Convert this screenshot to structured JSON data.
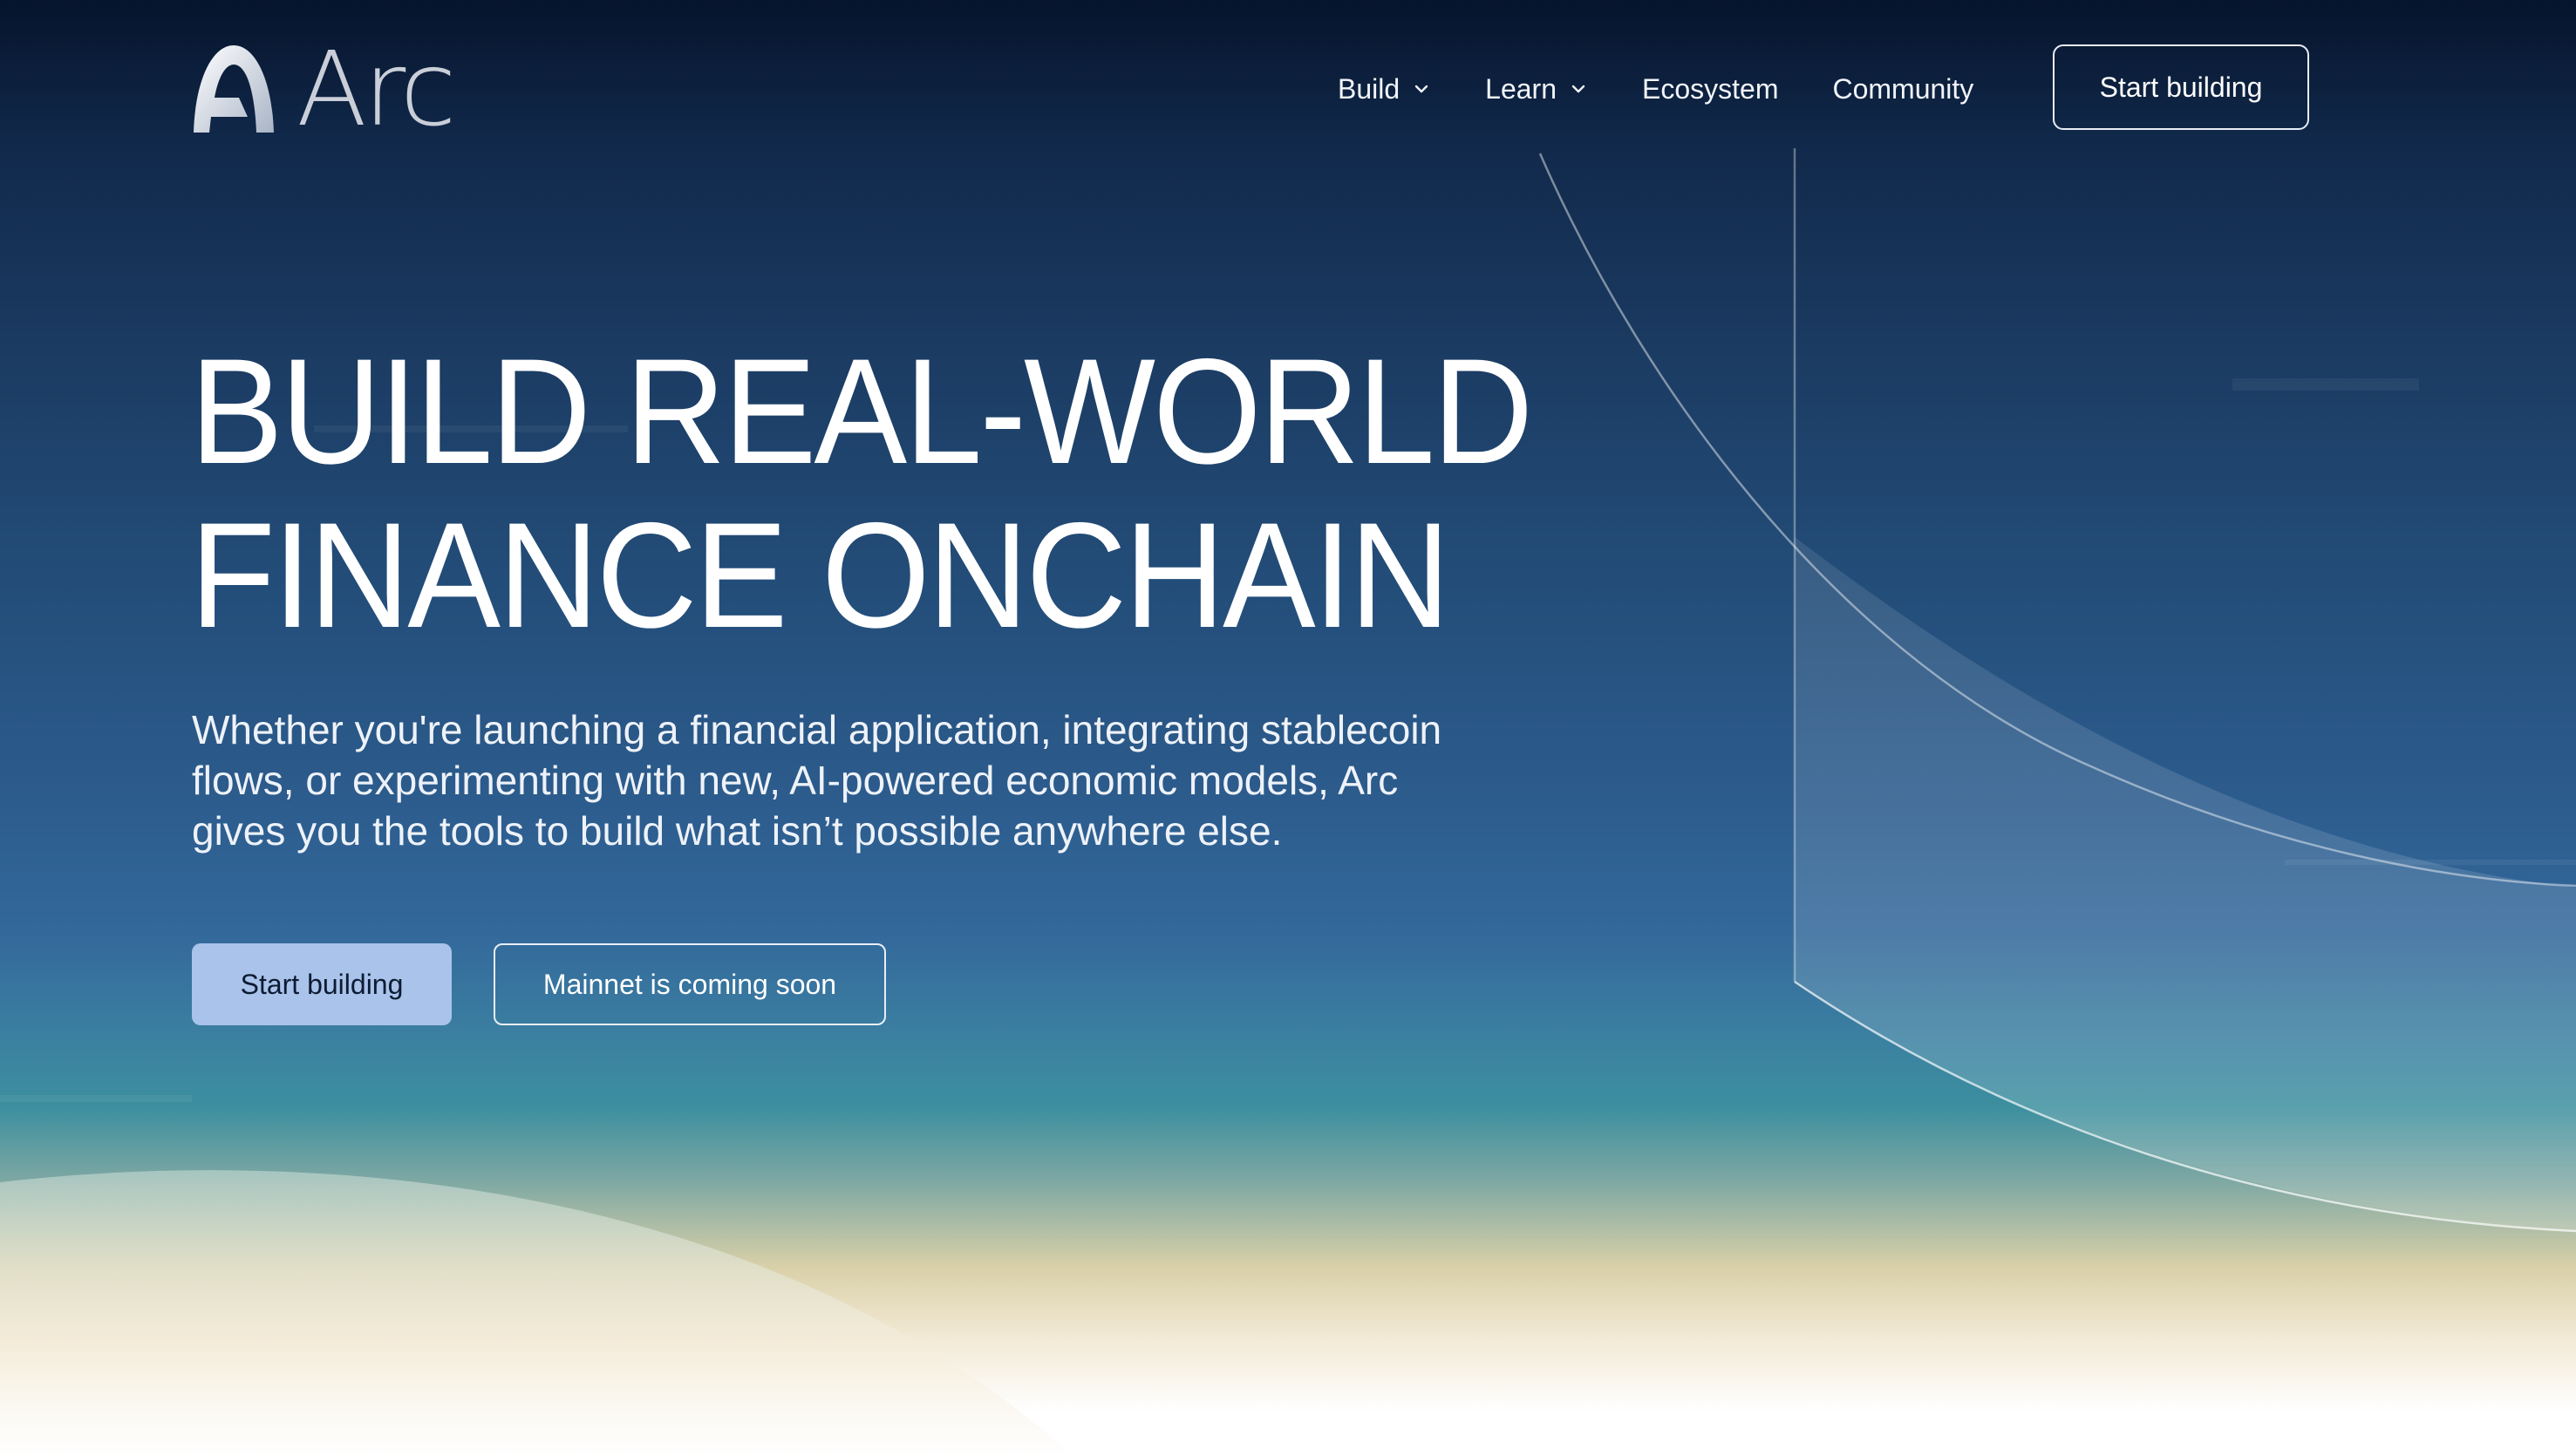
{
  "brand": {
    "name": "Arc",
    "logo_icon": "arc-logo-icon"
  },
  "nav": {
    "items": [
      {
        "label": "Build",
        "has_dropdown": true
      },
      {
        "label": "Learn",
        "has_dropdown": true
      },
      {
        "label": "Ecosystem",
        "has_dropdown": false
      },
      {
        "label": "Community",
        "has_dropdown": false
      }
    ],
    "cta_label": "Start building"
  },
  "hero": {
    "title_lines": [
      "BUILD REAL-WORLD",
      "FINANCE ONCHAIN"
    ],
    "subtitle_lines": [
      "Whether you're launching a financial application, integrating stablecoin",
      "flows, or experimenting with new, AI-powered economic models, Arc",
      "gives you the tools to build what isn’t possible anywhere else."
    ],
    "primary_button": "Start building",
    "secondary_button": "Mainnet is coming soon"
  },
  "colors": {
    "primary_button_bg": "#a9c3ea",
    "background_top": "#06142c",
    "background_mid": "#2c5c8d",
    "background_bottom": "#ffffff"
  }
}
